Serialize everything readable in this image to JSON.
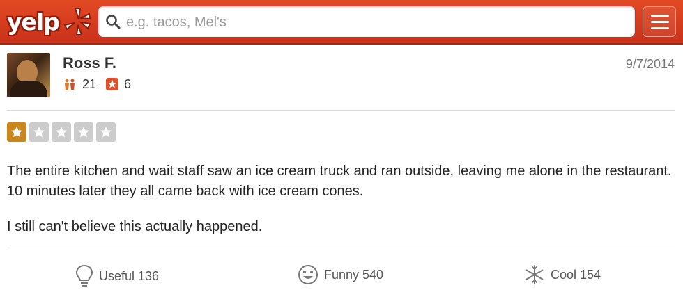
{
  "header": {
    "logo_text": "yelp",
    "search_placeholder": "e.g. tacos, Mel's",
    "colors": {
      "bar": "#d93a1e",
      "white": "#ffffff"
    }
  },
  "review": {
    "user_name": "Ross F.",
    "friends_count": "21",
    "reviews_count": "6",
    "date": "9/7/2014",
    "rating": 1,
    "max_rating": 5,
    "paragraphs": [
      "The entire kitchen and wait staff saw an ice cream truck and ran outside, leaving me alone in the restaurant. 10 minutes later they all came back with ice cream cones.",
      "I still can't believe this actually happened."
    ],
    "colors": {
      "star_on": "#c8861d",
      "star_off": "#cccccc",
      "text": "#222222"
    }
  },
  "actions": {
    "useful_label": "Useful 136",
    "funny_label": "Funny 540",
    "cool_label": "Cool 154"
  }
}
